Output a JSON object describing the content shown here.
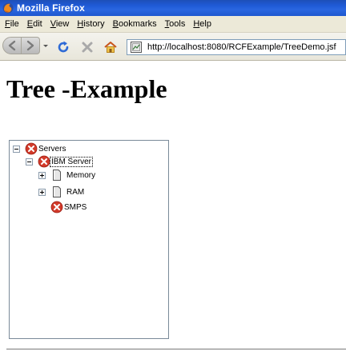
{
  "window": {
    "title": "Mozilla Firefox"
  },
  "menubar": {
    "items": [
      {
        "accel": "F",
        "rest": "ile"
      },
      {
        "accel": "E",
        "rest": "dit"
      },
      {
        "accel": "V",
        "rest": "iew"
      },
      {
        "accel": "H",
        "rest": "istory"
      },
      {
        "accel": "B",
        "rest": "ookmarks"
      },
      {
        "accel": "T",
        "rest": "ools"
      },
      {
        "accel": "H",
        "rest": "elp"
      }
    ]
  },
  "navbar": {
    "icons": [
      "back-icon",
      "forward-icon",
      "reload-icon",
      "stop-icon",
      "home-icon"
    ],
    "url": "http://localhost:8080/RCFExample/TreeDemo.jsf"
  },
  "page": {
    "heading": "Tree -Example"
  },
  "tree": {
    "nodes": [
      {
        "label": "Servers",
        "icon": "error-icon",
        "expander": "collapse",
        "selected": false
      },
      {
        "label": "IBM Server",
        "icon": "error-icon",
        "expander": "collapse",
        "selected": true
      },
      {
        "label": "Memory",
        "icon": "document-icon",
        "expander": "expand",
        "selected": false
      },
      {
        "label": "RAM",
        "icon": "document-icon",
        "expander": "expand",
        "selected": false
      },
      {
        "label": "SMPS",
        "icon": "error-icon",
        "expander": "none",
        "selected": false
      }
    ]
  },
  "colors": {
    "titlebar": "#1f5ad6",
    "menubar": "#ece9d8",
    "error_icon": "#d23a2a",
    "url_border": "#7f9db9"
  }
}
